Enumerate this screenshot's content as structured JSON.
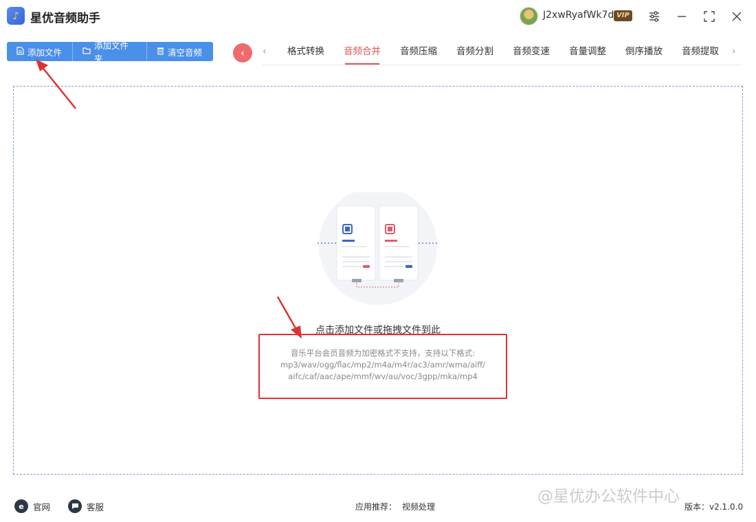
{
  "app": {
    "title": "星优音频助手",
    "logo_glyph": "♪"
  },
  "user": {
    "name": "J2xwRyafWk7d",
    "vip": "VIP"
  },
  "window_controls": {
    "settings": "⚙",
    "minimize": "—",
    "maximize": "⛶",
    "close": "✕"
  },
  "toolbar": {
    "add_file": "添加文件",
    "add_folder": "添加文件夹",
    "clear_audio": "清空音频"
  },
  "tabs": [
    {
      "label": "格式转换",
      "active": false
    },
    {
      "label": "音频合并",
      "active": true
    },
    {
      "label": "音频压缩",
      "active": false
    },
    {
      "label": "音频分割",
      "active": false
    },
    {
      "label": "音频变速",
      "active": false
    },
    {
      "label": "音量调整",
      "active": false
    },
    {
      "label": "倒序播放",
      "active": false
    },
    {
      "label": "音频提取",
      "active": false
    }
  ],
  "dropzone": {
    "hint": "点击添加文件或拖拽文件到此",
    "formats": [
      "音乐平台会员音频为加密格式不支持，支持以下格式:",
      "mp3/wav/ogg/flac/mp2/m4a/m4r/ac3/amr/wma/aiff/",
      "aifc/caf/aac/ape/mmf/wv/au/voc/3gpp/mka/mp4"
    ]
  },
  "footer": {
    "website": "官网",
    "support": "客服",
    "recommend_label": "应用推荐：",
    "recommend_link": "视频处理",
    "watermark": "@星优办公软件中心",
    "version": "版本：v2.1.0.0"
  },
  "colors": {
    "accent_blue": "#4a8fe8",
    "accent_red": "#e05555",
    "highlight_red": "#e03131"
  }
}
